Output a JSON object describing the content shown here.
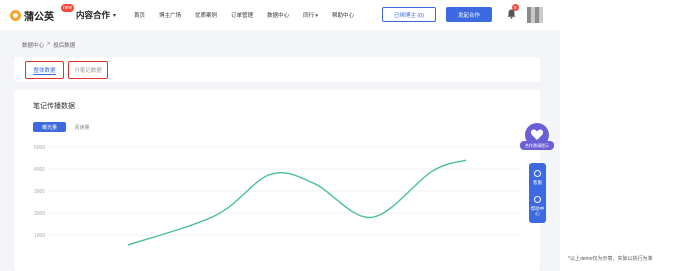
{
  "header": {
    "logo_text": "蒲公英",
    "logo_badge": "new",
    "business_menu": "内容合作",
    "nav_items": [
      {
        "label": "首页",
        "caret": false
      },
      {
        "label": "博主广场",
        "caret": false
      },
      {
        "label": "优质案例",
        "caret": false
      },
      {
        "label": "订单管理",
        "caret": false
      },
      {
        "label": "数据中心",
        "caret": false
      },
      {
        "label": "同行",
        "caret": true
      },
      {
        "label": "帮助中心",
        "caret": false
      }
    ],
    "bound_blogger_button": "已绑博主 (0)",
    "start_collab_button": "发起合作",
    "bell_count": "8"
  },
  "breadcrumb": {
    "root": "数据中心",
    "separator": ">",
    "current": "投后数据"
  },
  "tabs": [
    "整体数据",
    "分笔记数据"
  ],
  "main": {
    "card_title": "笔记传播数据",
    "segments": [
      "曝光量",
      "阅读量"
    ]
  },
  "chart_data": {
    "type": "line",
    "ylim": [
      0,
      5000
    ],
    "yticks": [
      "5000",
      "4000",
      "3000",
      "2000",
      "1000"
    ],
    "series": [
      {
        "values": [
          {
            "x": 0.0,
            "y": 0
          },
          {
            "x": 0.26,
            "y": 1900
          },
          {
            "x": 0.42,
            "y": 3750
          },
          {
            "x": 0.55,
            "y": 3350
          },
          {
            "x": 0.72,
            "y": 1800
          },
          {
            "x": 0.9,
            "y": 3900
          },
          {
            "x": 1.0,
            "y": 4400
          }
        ],
        "color": "#4ac09a"
      }
    ],
    "grid": true
  },
  "float": {
    "likes_label": "合作邀请提示",
    "side_items": [
      "客服",
      "帮助中心"
    ]
  },
  "disclaimer": "*以上demo仅为示意，实际以执行为准",
  "colors": {
    "accent": "#3d6ae0",
    "highlight_border": "#e0312b",
    "line": "#4ac09a"
  }
}
